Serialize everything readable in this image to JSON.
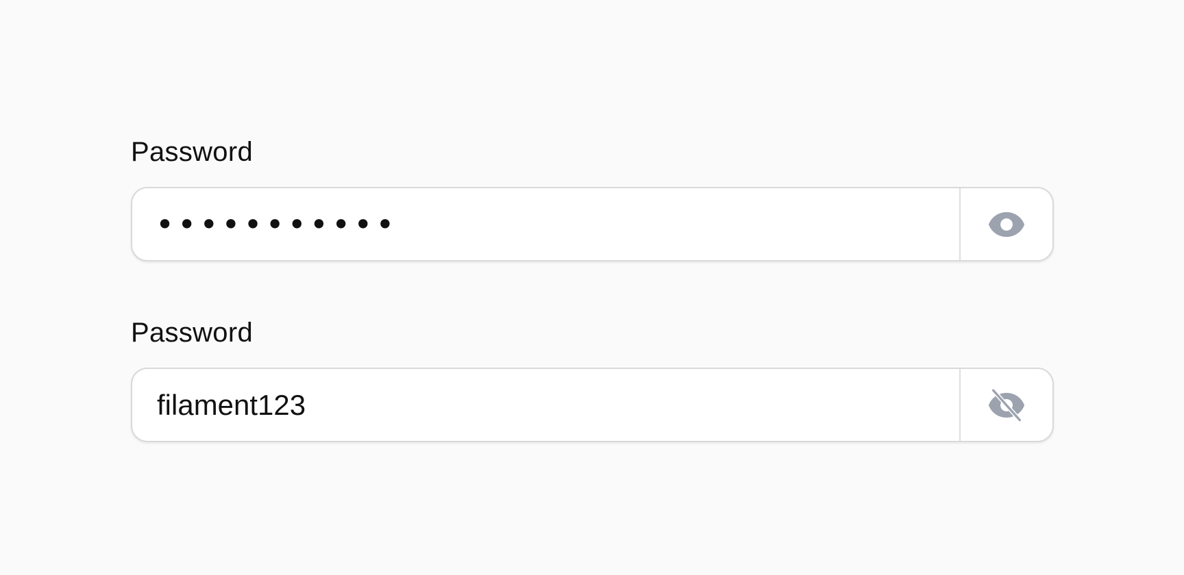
{
  "fields": [
    {
      "label": "Password",
      "value": "•••••••••••",
      "visibility_icon": "eye-icon"
    },
    {
      "label": "Password",
      "value": "filament123",
      "visibility_icon": "eye-slash-icon"
    }
  ],
  "colors": {
    "background": "#fafafa",
    "input_border": "#d9d9dc",
    "icon": "#9ca3af",
    "text": "#111111"
  }
}
